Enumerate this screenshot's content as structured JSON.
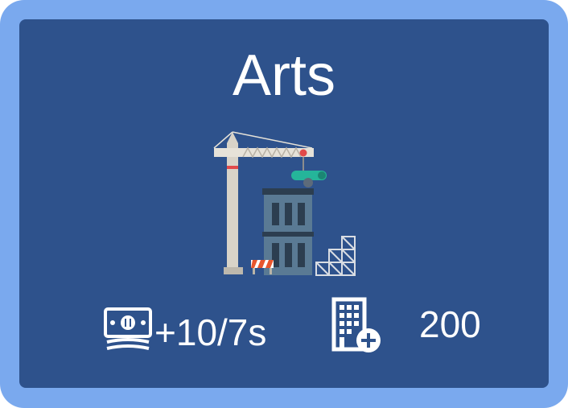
{
  "card": {
    "title": "Arts",
    "illustration": "crane-construction-icon",
    "income": {
      "icon": "cash-icon",
      "label": "+10/7s"
    },
    "build": {
      "icon": "building-add-icon",
      "cost_label": "200"
    }
  },
  "colors": {
    "frame": "#7aa9ee",
    "panel": "#2e528c",
    "text": "#ffffff"
  }
}
